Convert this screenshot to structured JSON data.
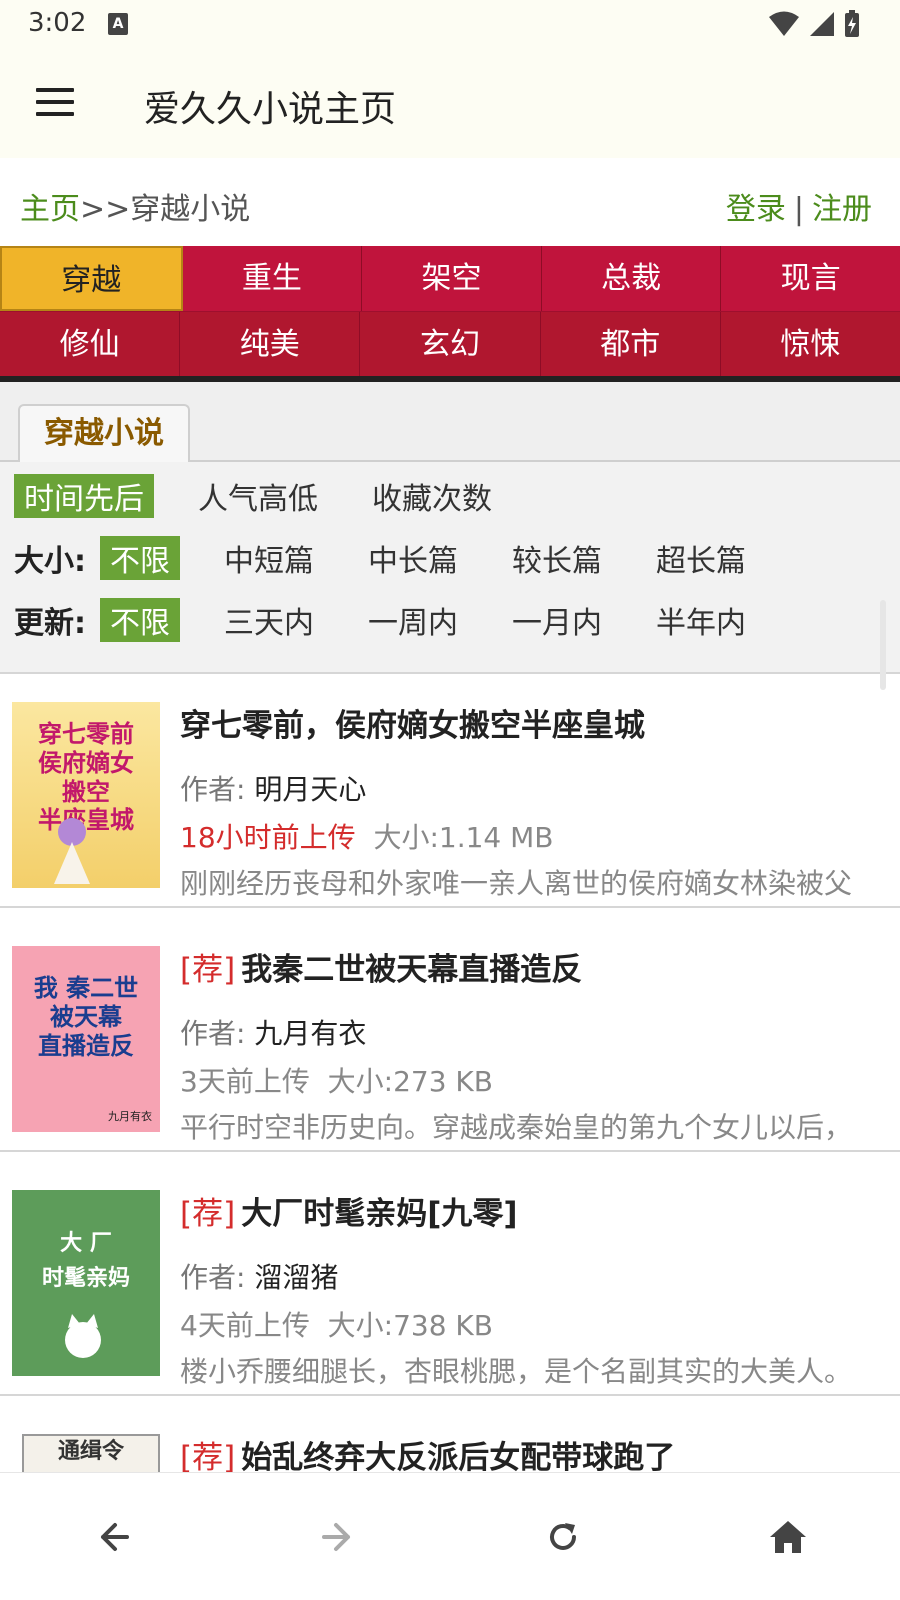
{
  "status": {
    "time": "3:02",
    "a_badge": "A"
  },
  "app_bar": {
    "title": "爱久久小说主页"
  },
  "breadcrumb": {
    "home": "主页",
    "separator": ">>",
    "current": "穿越小说"
  },
  "auth": {
    "login": "登录",
    "divider": "|",
    "register": "注册"
  },
  "categories": {
    "row1": [
      "穿越",
      "重生",
      "架空",
      "总裁",
      "现言"
    ],
    "row2": [
      "修仙",
      "纯美",
      "玄幻",
      "都市",
      "惊悚"
    ]
  },
  "tab": {
    "label": "穿越小说"
  },
  "filters": {
    "sort": [
      "时间先后",
      "人气高低",
      "收藏次数"
    ],
    "size": {
      "label": "大小:",
      "options": [
        "不限",
        "中短篇",
        "中长篇",
        "较长篇",
        "超长篇"
      ]
    },
    "update": {
      "label": "更新:",
      "options": [
        "不限",
        "三天内",
        "一周内",
        "一月内",
        "半年内"
      ]
    }
  },
  "books": [
    {
      "tag": "",
      "title": "穿七零前，侯府嫡女搬空半座皇城",
      "author_label": "作者:",
      "author": "明月天心",
      "uploaded": "18小时前上传",
      "size": "大小:1.14 MB",
      "desc": "刚刚经历丧母和外家唯一亲人离世的侯府嫡女林染被父",
      "cover_text": "穿七零前\n侯府嫡女\n搬空\n半座皇城"
    },
    {
      "tag": "[荐]",
      "title": "我秦二世被天幕直播造反",
      "author_label": "作者:",
      "author": "九月有衣",
      "uploaded": "3天前上传",
      "size": "大小:273 KB",
      "desc": "平行时空非历史向。穿越成秦始皇的第九个女儿以后，",
      "cover_text": "我 秦二世\n被天幕\n直播造反",
      "cover_sign": "九月有衣"
    },
    {
      "tag": "[荐]",
      "title": "大厂时髦亲妈[九零]",
      "author_label": "作者:",
      "author": "溜溜猪",
      "uploaded": "4天前上传",
      "size": "大小:738 KB",
      "desc": "楼小乔腰细腿长，杏眼桃腮，是个名副其实的大美人。",
      "cover_text": "大 厂\n时髦亲妈"
    },
    {
      "tag": "[荐]",
      "title": "始乱终弃大反派后女配带球跑了",
      "cover_text": "通缉令"
    }
  ],
  "colors": {
    "green": "#6aa337",
    "red_bar": "#c0143c",
    "active_gold": "#f0b429",
    "tag_red": "#d42c2c"
  }
}
